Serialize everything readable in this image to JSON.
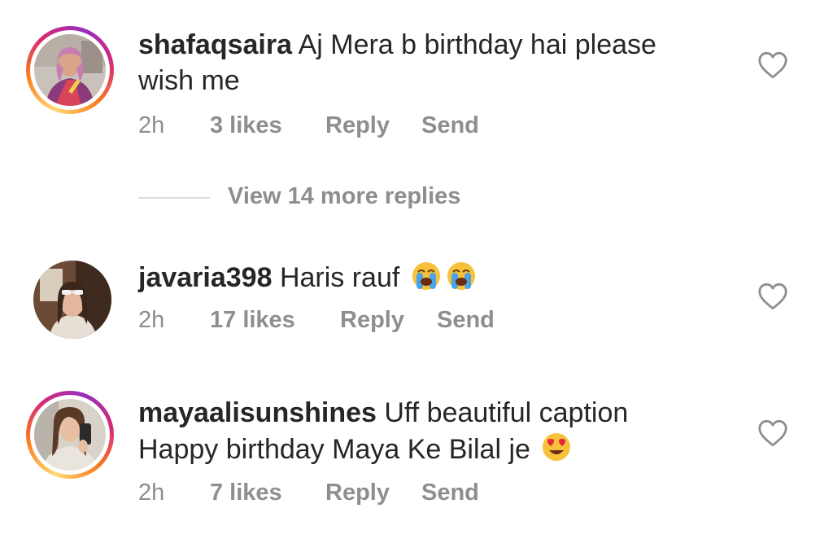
{
  "comments": [
    {
      "username": "shafaqsaira",
      "text_line1": "Aj Mera b birthday hai please",
      "text_line2": "wish me",
      "time": "2h",
      "likes": "3 likes",
      "reply_label": "Reply",
      "send_label": "Send",
      "story_ring": true
    },
    {
      "username": "javaria398",
      "text_line1": "Haris rauf",
      "emojis": [
        "loudly-crying-face",
        "loudly-crying-face"
      ],
      "time": "2h",
      "likes": "17 likes",
      "reply_label": "Reply",
      "send_label": "Send",
      "story_ring": false
    },
    {
      "username": "mayaalisunshines",
      "text_line1": "Uff beautiful caption",
      "text_line2": "Happy birthday Maya Ke Bilal je",
      "emojis": [
        "smiling-face-with-heart-eyes"
      ],
      "time": "2h",
      "likes": "7 likes",
      "reply_label": "Reply",
      "send_label": "Send",
      "story_ring": true
    }
  ],
  "view_replies_label": "View 14 more replies",
  "colors": {
    "text": "#262626",
    "secondary": "#8e8e8e",
    "divider": "#dbdbdb",
    "story_ring": [
      "#feda75",
      "#fa7e1e",
      "#d62976",
      "#962fbf"
    ]
  }
}
